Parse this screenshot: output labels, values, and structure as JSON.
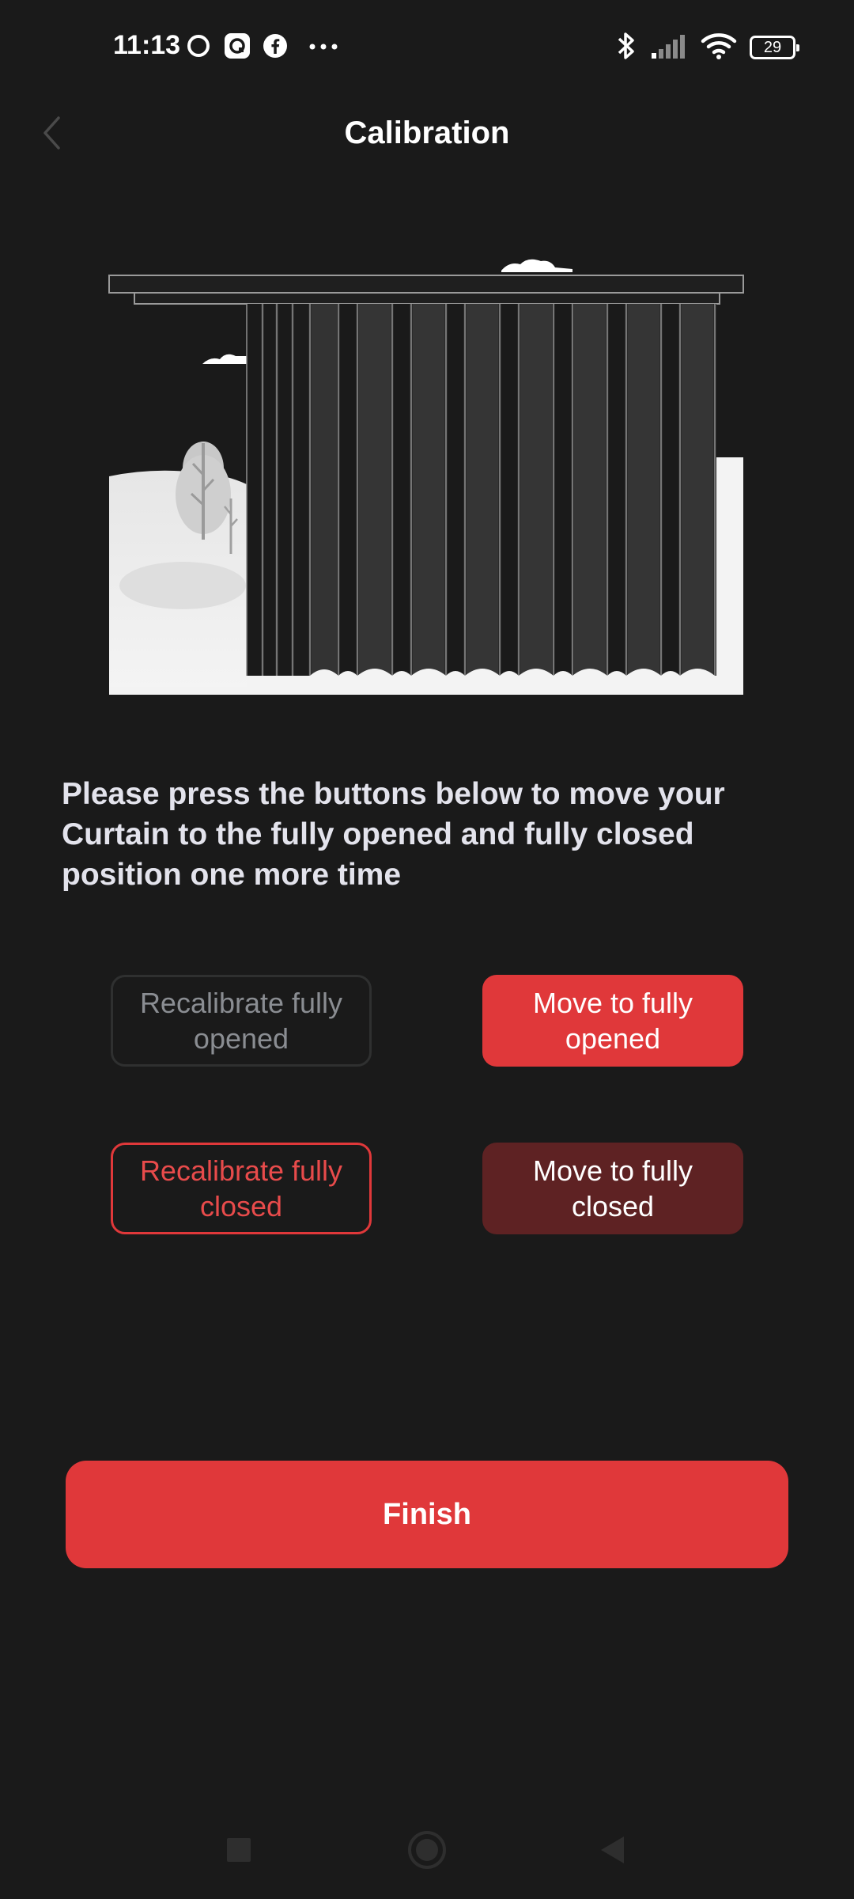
{
  "status_bar": {
    "time": "11:13",
    "battery": "29",
    "left_icons": [
      "ring-icon",
      "camera-app-icon",
      "facebook-icon",
      "more-dots-icon"
    ],
    "right_icons": [
      "bluetooth-icon",
      "signal-icon",
      "wifi-icon",
      "battery-icon"
    ]
  },
  "header": {
    "title": "Calibration",
    "back_icon": "chevron-left-icon"
  },
  "instruction": "Please press the buttons below to move your Curtain to the fully opened and fully closed position one more time",
  "buttons": {
    "recalibrate_opened": "Recalibrate fully opened",
    "move_opened": "Move to fully opened",
    "recalibrate_closed": "Recalibrate fully closed",
    "move_closed": "Move to fully closed"
  },
  "finish": "Finish",
  "nav_bar": {
    "icons": [
      "recents-square-icon",
      "home-circle-icon",
      "back-triangle-icon"
    ]
  },
  "colors": {
    "background": "#1a1a1a",
    "accent": "#e0383a",
    "accent_dark": "#5e2223",
    "disabled_text": "#8a8d92"
  }
}
